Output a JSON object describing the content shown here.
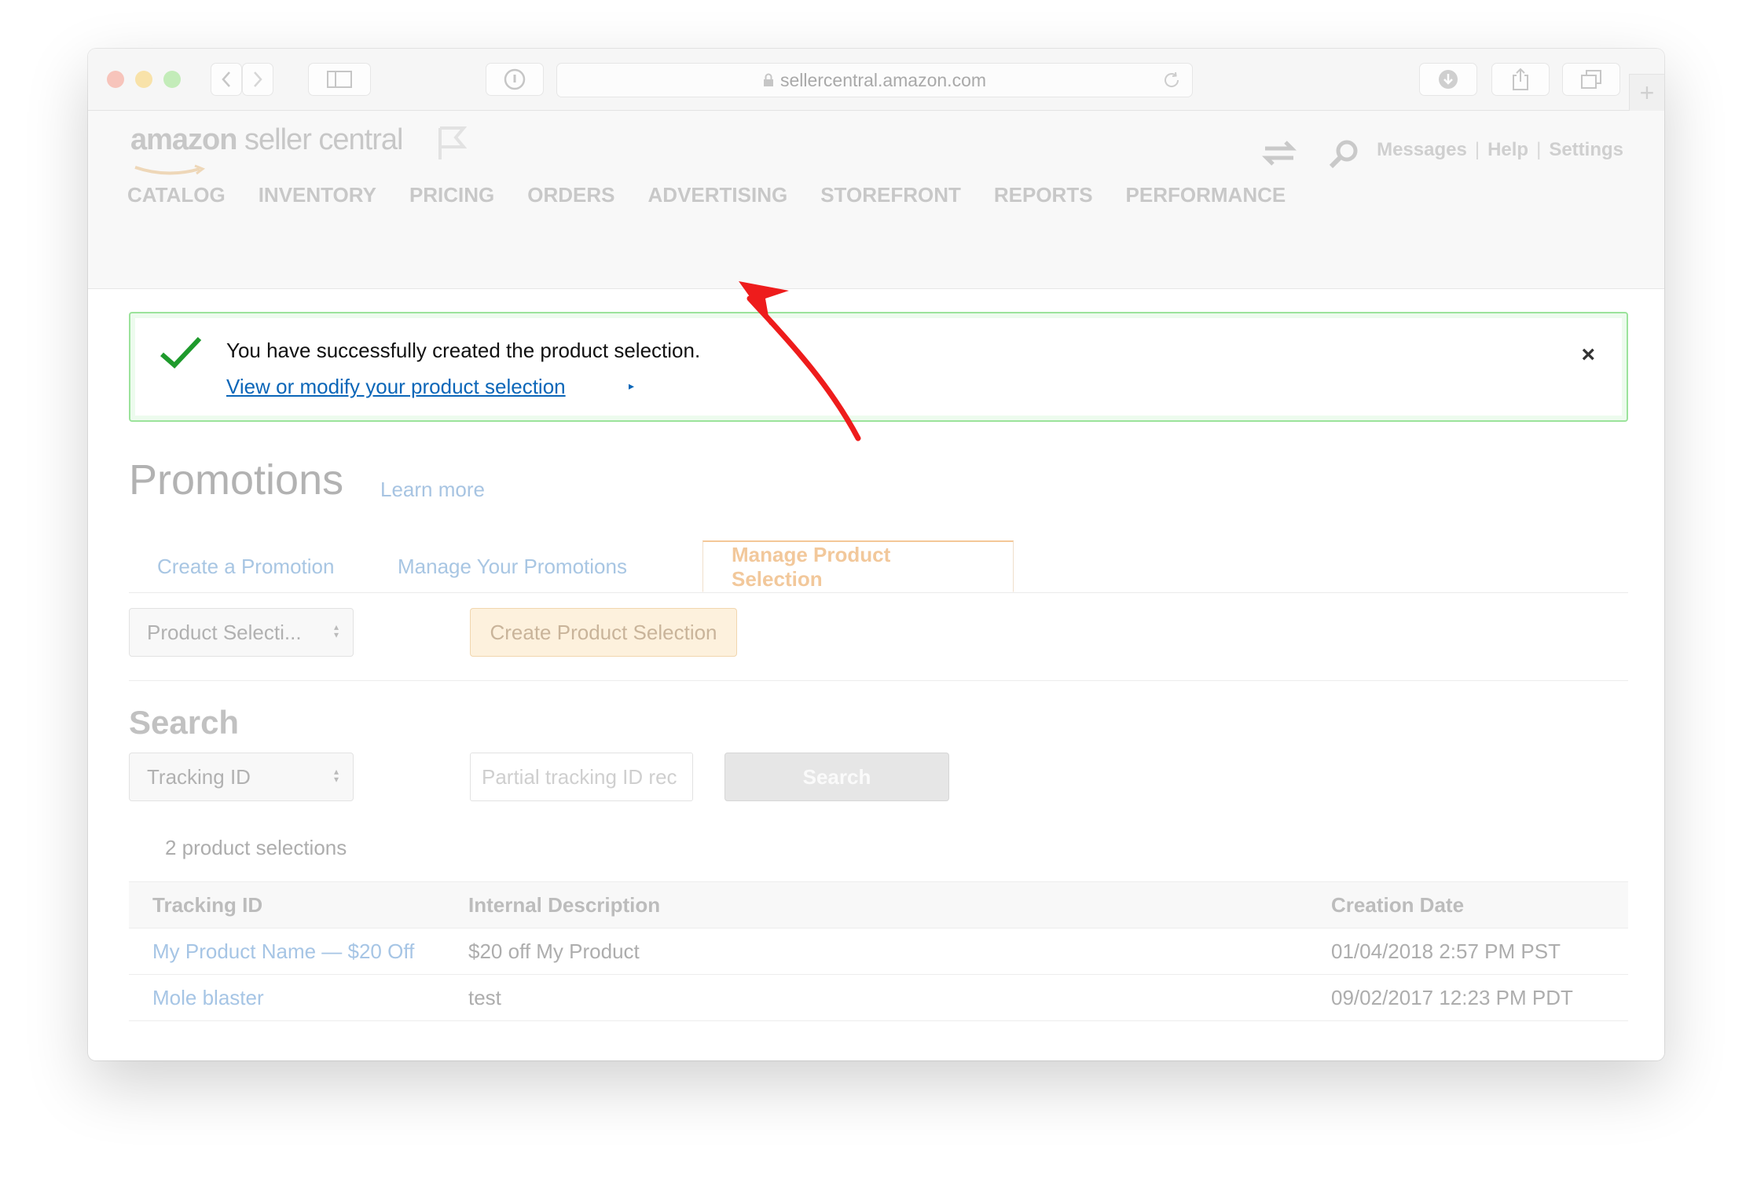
{
  "browser": {
    "url": "sellercentral.amazon.com",
    "colors": {
      "close": "#f7c4bb",
      "minimize": "#f8e2a9",
      "zoom": "#c3ecb9"
    }
  },
  "header": {
    "logo_bold": "amazon",
    "logo_rest": " seller central",
    "links": [
      "Messages",
      "Help",
      "Settings"
    ],
    "nav": [
      "CATALOG",
      "INVENTORY",
      "PRICING",
      "ORDERS",
      "ADVERTISING",
      "STOREFRONT",
      "REPORTS",
      "PERFORMANCE"
    ]
  },
  "alert": {
    "message": "You have successfully created the product selection.",
    "link": "View or modify your product selection",
    "caret": "▸",
    "close": "×"
  },
  "page": {
    "title": "Promotions",
    "learn_more": "Learn more",
    "tabs": [
      "Create a Promotion",
      "Manage Your Promotions",
      "Manage Product Selection"
    ]
  },
  "controls": {
    "type_select": "Product Selecti...",
    "create_button": "Create Product Selection",
    "search_heading": "Search",
    "search_select": "Tracking ID",
    "search_placeholder": "Partial tracking ID rec",
    "search_button": "Search"
  },
  "results": {
    "count": "2 product selections",
    "columns": [
      "Tracking ID",
      "Internal Description",
      "Creation Date"
    ],
    "rows": [
      [
        "My Product Name — $20 Off",
        "$20 off My Product",
        "01/04/2018 2:57 PM PST"
      ],
      [
        "Mole blaster",
        "test",
        "09/02/2017 12:23 PM PDT"
      ]
    ]
  }
}
